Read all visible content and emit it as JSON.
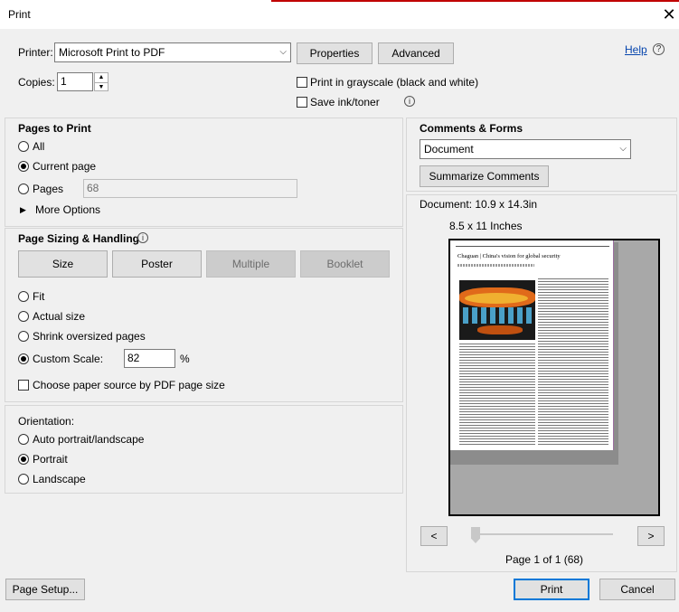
{
  "window": {
    "title": "Print",
    "close_glyph": "✕"
  },
  "printer": {
    "label": "Printer:",
    "selected": "Microsoft Print to PDF",
    "properties_label": "Properties",
    "advanced_label": "Advanced",
    "help_label": "Help",
    "help_icon": "?"
  },
  "copies": {
    "label": "Copies:",
    "value": "1"
  },
  "options": {
    "grayscale_label": "Print in grayscale (black and white)",
    "grayscale_checked": false,
    "save_ink_label": "Save ink/toner",
    "save_ink_checked": false,
    "info_glyph": "i"
  },
  "pages_to_print": {
    "title": "Pages to Print",
    "all_label": "All",
    "current_label": "Current page",
    "pages_label": "Pages",
    "pages_value": "68",
    "more_label": "More Options",
    "selected": "current"
  },
  "sizing": {
    "title": "Page Sizing & Handling",
    "tabs": [
      "Size",
      "Poster",
      "Multiple",
      "Booklet"
    ],
    "fit_label": "Fit",
    "actual_label": "Actual size",
    "shrink_label": "Shrink oversized pages",
    "custom_label": "Custom Scale:",
    "custom_value": "82",
    "percent": "%",
    "paper_source_label": "Choose paper source by PDF page size",
    "selected": "custom"
  },
  "orientation": {
    "title": "Orientation:",
    "auto_label": "Auto portrait/landscape",
    "portrait_label": "Portrait",
    "landscape_label": "Landscape",
    "selected": "portrait"
  },
  "comments": {
    "title": "Comments & Forms",
    "selected": "Document",
    "summarize_label": "Summarize Comments"
  },
  "preview": {
    "document_size": "Document: 10.9 x 14.3in",
    "paper_size": "8.5 x 11 Inches",
    "article_title": "Chaguan | China's vision for global security",
    "prev_label": "<",
    "next_label": ">",
    "page_status": "Page 1 of 1 (68)"
  },
  "footer": {
    "page_setup_label": "Page Setup...",
    "print_label": "Print",
    "cancel_label": "Cancel"
  },
  "colors": {
    "accent": "#c00000",
    "link": "#0645ad",
    "primary_border": "#0078d7"
  }
}
